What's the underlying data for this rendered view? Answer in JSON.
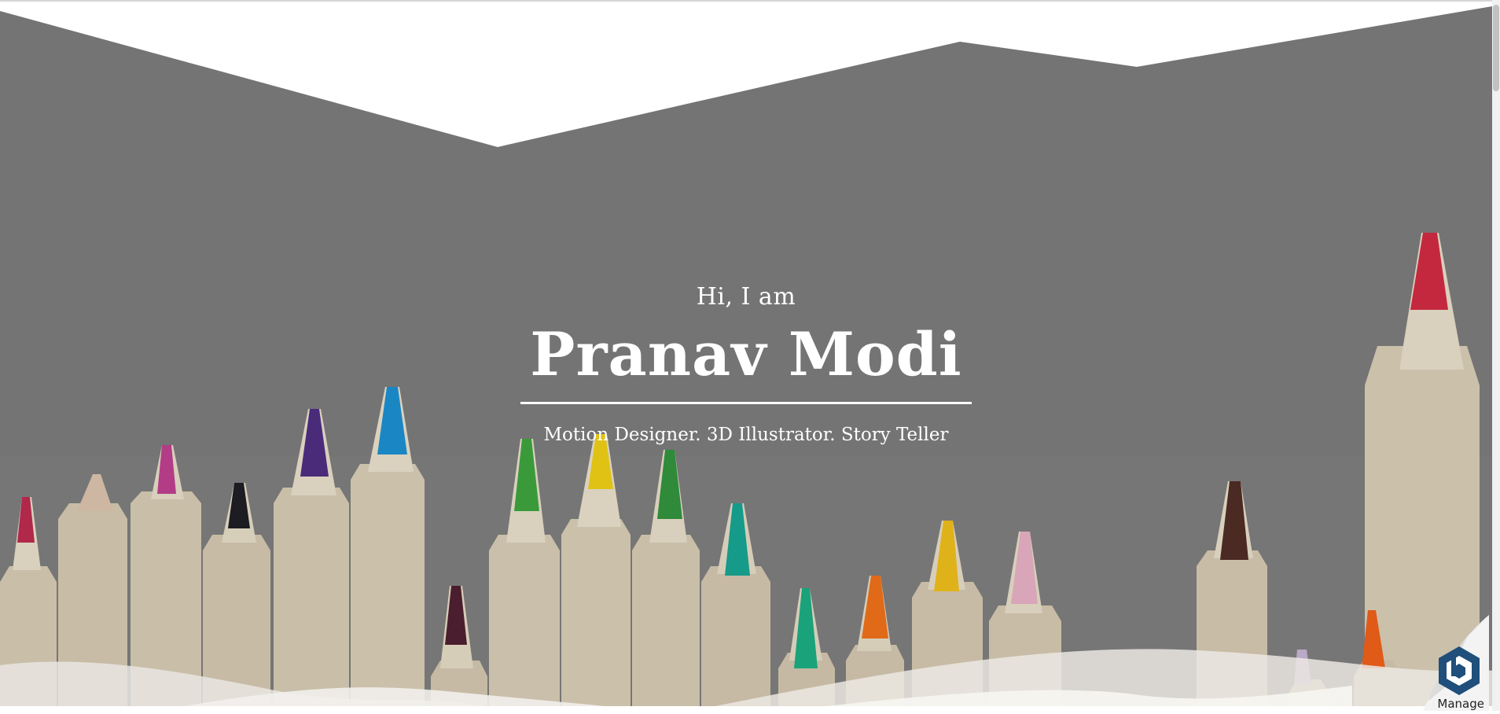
{
  "hero": {
    "greeting": "Hi, I am",
    "name": "Pranav Modi",
    "tagline": "Motion Designer. 3D Illustrator. Story Teller"
  },
  "manage_widget": {
    "label": "Manage",
    "icon": "b-hexagon-icon"
  },
  "colors": {
    "overlay": "#747474",
    "text": "#ffffff",
    "badge": "#1f4f7a"
  }
}
